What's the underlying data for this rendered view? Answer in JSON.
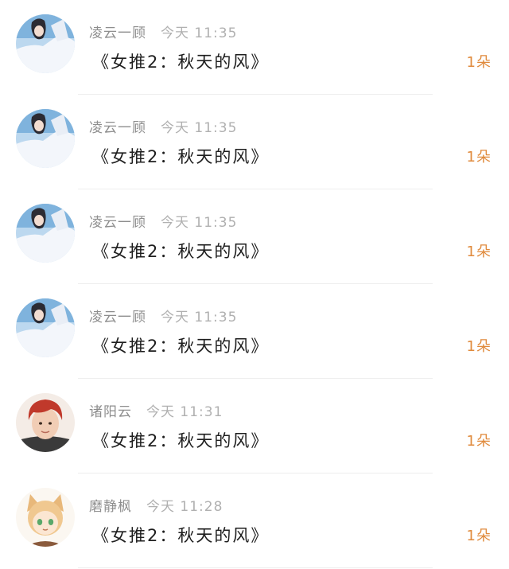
{
  "rows": [
    {
      "name": "凌云一顾",
      "time": "今天 11:35",
      "title": "《女推2：秋天的风》",
      "gift": "1朵",
      "avatar_icon": "girl-white-dress-avatar"
    },
    {
      "name": "凌云一顾",
      "time": "今天 11:35",
      "title": "《女推2：秋天的风》",
      "gift": "1朵",
      "avatar_icon": "girl-white-dress-avatar"
    },
    {
      "name": "凌云一顾",
      "time": "今天 11:35",
      "title": "《女推2：秋天的风》",
      "gift": "1朵",
      "avatar_icon": "girl-white-dress-avatar"
    },
    {
      "name": "凌云一顾",
      "time": "今天 11:35",
      "title": "《女推2：秋天的风》",
      "gift": "1朵",
      "avatar_icon": "girl-white-dress-avatar"
    },
    {
      "name": "诸阳云",
      "time": "今天 11:31",
      "title": "《女推2：秋天的风》",
      "gift": "1朵",
      "avatar_icon": "red-hair-person-avatar"
    },
    {
      "name": "磨静枫",
      "time": "今天 11:28",
      "title": "《女推2：秋天的风》",
      "gift": "1朵",
      "avatar_icon": "anime-cat-ears-avatar"
    }
  ],
  "colors": {
    "gift": "#e08a3c",
    "name": "#8e8e8e",
    "time": "#b0b0b0",
    "title": "#1e1e1e",
    "divider": "#eeeeee"
  }
}
